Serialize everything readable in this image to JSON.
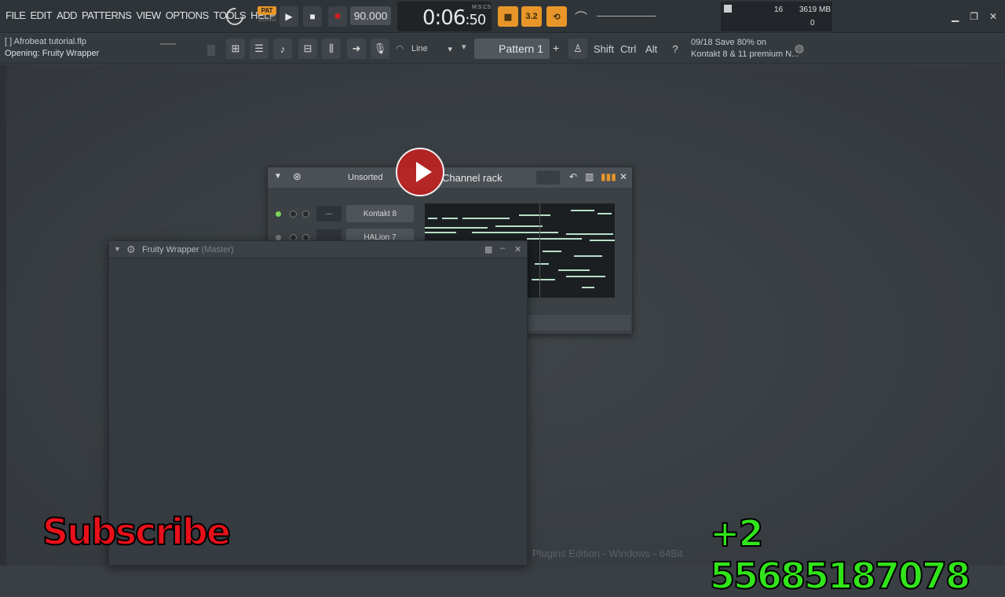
{
  "menu": [
    "FILE",
    "EDIT",
    "ADD",
    "PATTERNS",
    "VIEW",
    "OPTIONS",
    "TOOLS",
    "HELP"
  ],
  "transport": {
    "pat_label": "PAT",
    "song_label": "SONG",
    "play_icon": "▶",
    "stop_icon": "■",
    "record_icon": "●",
    "tempo": "90.000"
  },
  "time_display": {
    "main": "0:06",
    "sub": ":50",
    "format_label": "M:S:CS"
  },
  "stats": {
    "voices": "16",
    "memory": "3619 MB",
    "cpu": "0"
  },
  "project": {
    "filename": "[  ] Afrobeat tutorial.flp",
    "status": "Opening: Fruity Wrapper"
  },
  "toolbar": {
    "snap": "Line",
    "pattern": "Pattern 1",
    "add_pattern": "+",
    "shift": "Shift",
    "ctrl": "Ctrl",
    "alt": "Alt"
  },
  "news": {
    "line1": "09/18  Save 80% on",
    "line2": "Kontakt 8 & 11 premium N..."
  },
  "channel_rack": {
    "title": "Channel rack",
    "filter": "Unsorted",
    "channels": [
      {
        "name": "Kontakt 8"
      },
      {
        "name": "HALion 7"
      }
    ]
  },
  "fruity_wrapper": {
    "title": "Fruity Wrapper",
    "subtitle": "(Master)"
  },
  "footer": {
    "edition": "Plugins Edition - Windows - 64Bit"
  },
  "overlay": {
    "subscribe": "Subscribe",
    "phone": "+2 55685187078"
  },
  "colors": {
    "accent_orange": "#e8962a",
    "subscribe_red": "#e8101a",
    "phone_green": "#31e51a",
    "record_red": "#d02020"
  }
}
